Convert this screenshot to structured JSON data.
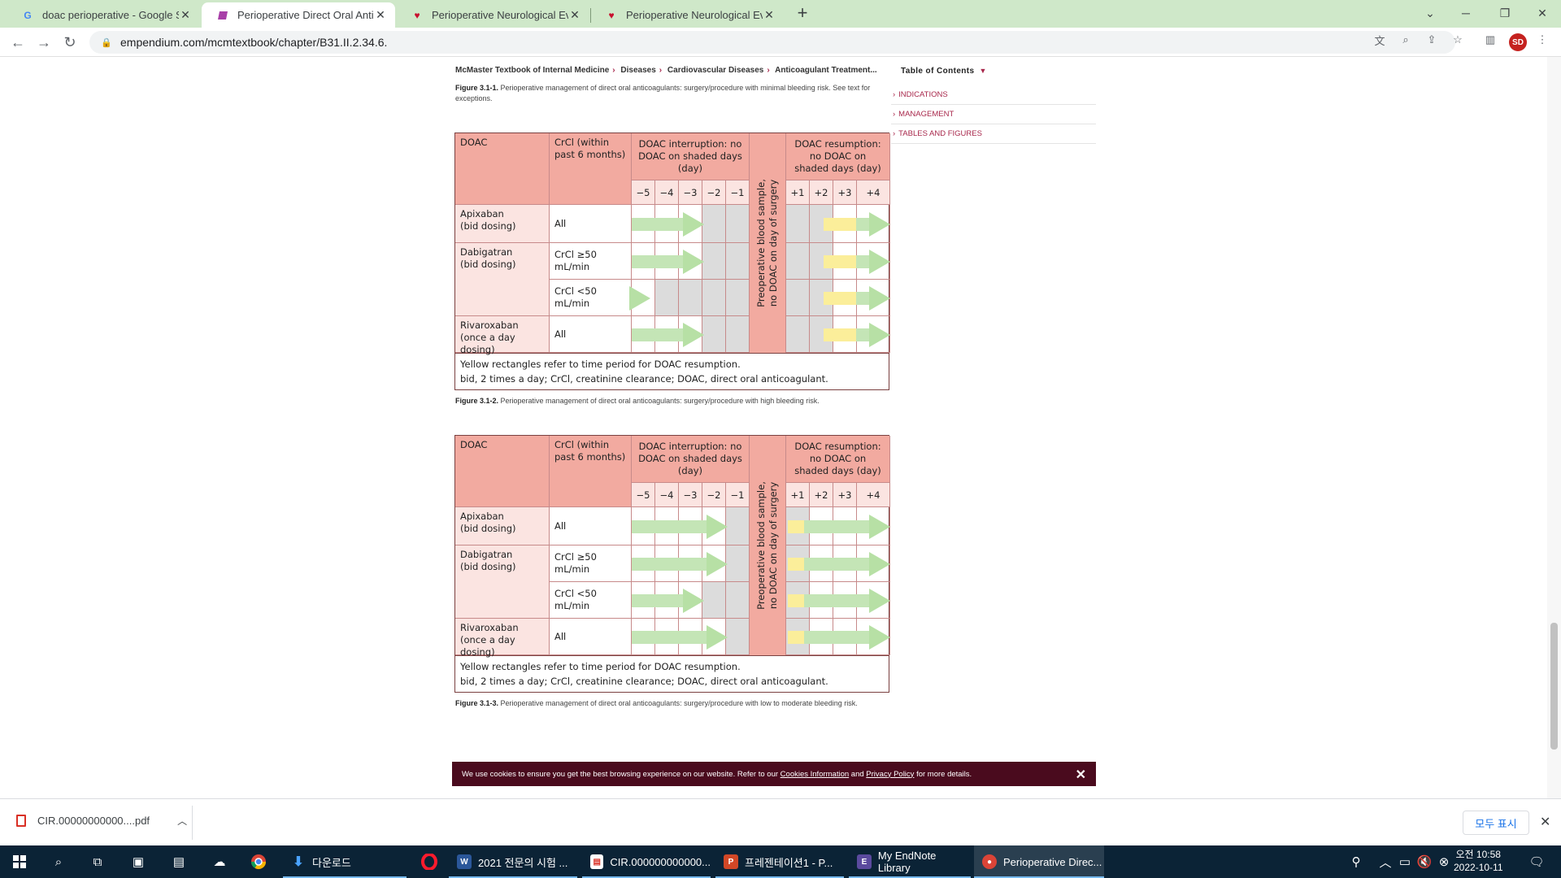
{
  "browser": {
    "tabs": [
      {
        "title": "doac perioperative - Google Se",
        "icon": "google-icon",
        "active": false
      },
      {
        "title": "Perioperative Direct Oral Antico",
        "icon": "empendium-icon",
        "active": true
      },
      {
        "title": "Perioperative Neurological Evalu",
        "icon": "aha-icon",
        "active": false
      },
      {
        "title": "Perioperative Neurological Evalu",
        "icon": "aha-icon",
        "active": false
      }
    ],
    "url": "empendium.com/mcmtextbook/chapter/B31.II.2.34.6.",
    "profile_initials": "SD"
  },
  "page": {
    "breadcrumb": [
      "McMaster Textbook of Internal Medicine",
      "Diseases",
      "Cardiovascular Diseases",
      "Anticoagulant Treatment..."
    ],
    "toc": {
      "header": "Table of Contents",
      "items": [
        "INDICATIONS",
        "MANAGEMENT",
        "TABLES AND FIGURES"
      ]
    },
    "captions": {
      "fig1_label": "Figure 3.1-1.",
      "fig1_text": "Perioperative management of direct oral anticoagulants: surgery/procedure with minimal bleeding risk. See text for exceptions.",
      "fig2_label": "Figure 3.1-2.",
      "fig2_text": "Perioperative management of direct oral anticoagulants: surgery/procedure with high bleeding risk.",
      "fig3_label": "Figure 3.1-3.",
      "fig3_text": "Perioperative management of direct oral anticoagulants: surgery/procedure with low to moderate bleeding risk."
    },
    "table": {
      "col_doac": "DOAC",
      "col_crcl": "CrCl (within past 6 months)",
      "col_interruption": "DOAC interruption: no DOAC on shaded days (day)",
      "col_resumption": "DOAC resumption: no DOAC on shaded days (day)",
      "vertical_label_1": "Preoperative blood sample,",
      "vertical_label_2": "no DOAC on day of surgery",
      "days_before": [
        "−5",
        "−4",
        "−3",
        "−2",
        "−1"
      ],
      "days_after": [
        "+1",
        "+2",
        "+3",
        "+4"
      ],
      "drugs": [
        {
          "name": "Apixaban",
          "dosing": "(bid dosing)"
        },
        {
          "name": "Dabigatran",
          "dosing": "(bid dosing)"
        },
        {
          "name": "Rivaroxaban",
          "dosing": "(once a day dosing)"
        }
      ],
      "crcl_rows": [
        "All",
        "CrCl ≥50 mL/min",
        "CrCl <50 mL/min",
        "All"
      ],
      "footnote_1": "Yellow rectangles refer to time period for DOAC resumption.",
      "footnote_2": "bid, 2 times a day; CrCl, creatinine clearance; DOAC, direct oral anticoagulant."
    },
    "cookie": {
      "text_before": "We use cookies to ensure you get the best browsing experience on our website. Refer to our",
      "link1": "Cookies Information",
      "and": "and",
      "link2": "Privacy Policy",
      "text_after": "for more details."
    }
  },
  "downloads": {
    "file": "CIR.00000000000....pdf",
    "show_all": "모두 표시"
  },
  "taskbar": {
    "apps": [
      {
        "label": "다운로드",
        "icon": "download-icon"
      },
      {
        "label": "2021 전문의 시험 ...",
        "icon": "word-icon"
      },
      {
        "label": "CIR.000000000000...",
        "icon": "pdf-icon"
      },
      {
        "label": "프레젠테이션1 - P...",
        "icon": "powerpoint-icon"
      },
      {
        "label": "My EndNote Library",
        "icon": "endnote-icon"
      },
      {
        "label": "Perioperative Direc...",
        "icon": "chrome-icon"
      }
    ],
    "clock_ampm": "오전 10:58",
    "clock_date": "2022-10-11"
  }
}
